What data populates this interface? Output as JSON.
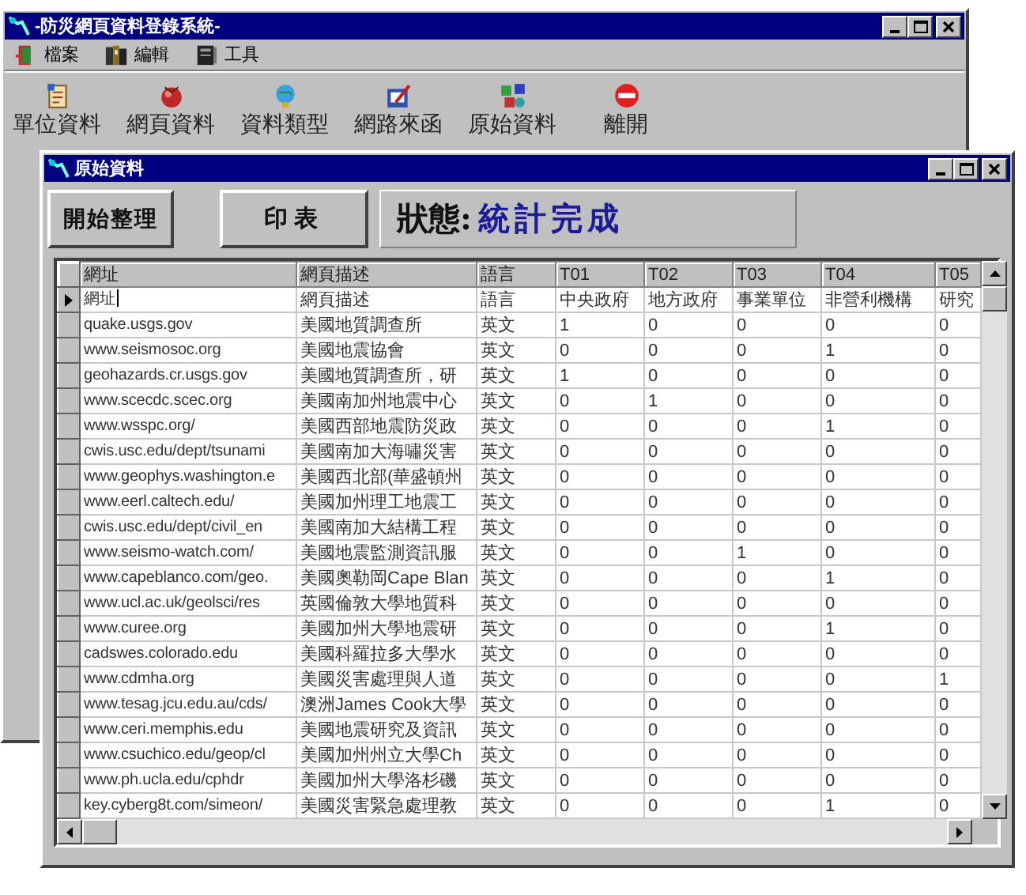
{
  "main_window": {
    "title": "-防災網頁資料登錄系統-",
    "menu": [
      {
        "label": "檔案"
      },
      {
        "label": "編輯"
      },
      {
        "label": "工具"
      }
    ],
    "toolbar": [
      {
        "label": "單位資料"
      },
      {
        "label": "網頁資料"
      },
      {
        "label": "資料類型"
      },
      {
        "label": "網路來函"
      },
      {
        "label": "原始資料"
      },
      {
        "label": "離開"
      }
    ]
  },
  "data_window": {
    "title": "原始資料",
    "buttons": [
      "開始整理",
      "印表"
    ],
    "status": {
      "label": "狀態:",
      "value": "統計完成"
    },
    "table": {
      "columns": [
        "網址",
        "網頁描述",
        "語言",
        "T01",
        "T02",
        "T03",
        "T04",
        "T05"
      ],
      "rows": [
        {
          "current": true,
          "cells": [
            "網址",
            "網頁描述",
            "語言",
            "中央政府",
            "地方政府",
            "事業單位",
            "非營利機構",
            "研究"
          ]
        },
        {
          "current": false,
          "cells": [
            "quake.usgs.gov",
            "美國地質調查所",
            "英文",
            "1",
            "0",
            "0",
            "0",
            "0"
          ]
        },
        {
          "current": false,
          "cells": [
            "www.seismosoc.org",
            "美國地震協會",
            "英文",
            "0",
            "0",
            "0",
            "1",
            "0"
          ]
        },
        {
          "current": false,
          "cells": [
            "geohazards.cr.usgs.gov",
            "美國地質調查所，研",
            "英文",
            "1",
            "0",
            "0",
            "0",
            "0"
          ]
        },
        {
          "current": false,
          "cells": [
            "www.scecdc.scec.org",
            "美國南加州地震中心",
            "英文",
            "0",
            "1",
            "0",
            "0",
            "0"
          ]
        },
        {
          "current": false,
          "cells": [
            "www.wsspc.org/",
            "美國西部地震防災政",
            "英文",
            "0",
            "0",
            "0",
            "1",
            "0"
          ]
        },
        {
          "current": false,
          "cells": [
            "cwis.usc.edu/dept/tsunami",
            "美國南加大海嘯災害",
            "英文",
            "0",
            "0",
            "0",
            "0",
            "0"
          ]
        },
        {
          "current": false,
          "cells": [
            "www.geophys.washington.e",
            "美國西北部(華盛頓州",
            "英文",
            "0",
            "0",
            "0",
            "0",
            "0"
          ]
        },
        {
          "current": false,
          "cells": [
            "www.eerl.caltech.edu/",
            "美國加州理工地震工",
            "英文",
            "0",
            "0",
            "0",
            "0",
            "0"
          ]
        },
        {
          "current": false,
          "cells": [
            "cwis.usc.edu/dept/civil_en",
            "美國南加大結構工程",
            "英文",
            "0",
            "0",
            "0",
            "0",
            "0"
          ]
        },
        {
          "current": false,
          "cells": [
            "www.seismo-watch.com/",
            "美國地震監測資訊服",
            "英文",
            "0",
            "0",
            "1",
            "0",
            "0"
          ]
        },
        {
          "current": false,
          "cells": [
            "www.capeblanco.com/geo.",
            "美國奧勒岡Cape Blan",
            "英文",
            "0",
            "0",
            "0",
            "1",
            "0"
          ]
        },
        {
          "current": false,
          "cells": [
            "www.ucl.ac.uk/geolsci/res",
            "英國倫敦大學地質科",
            "英文",
            "0",
            "0",
            "0",
            "0",
            "0"
          ]
        },
        {
          "current": false,
          "cells": [
            "www.curee.org",
            "美國加州大學地震研",
            "英文",
            "0",
            "0",
            "0",
            "1",
            "0"
          ]
        },
        {
          "current": false,
          "cells": [
            "cadswes.colorado.edu",
            "美國科羅拉多大學水",
            "英文",
            "0",
            "0",
            "0",
            "0",
            "0"
          ]
        },
        {
          "current": false,
          "cells": [
            "www.cdmha.org",
            "美國災害處理與人道",
            "英文",
            "0",
            "0",
            "0",
            "0",
            "1"
          ]
        },
        {
          "current": false,
          "cells": [
            "www.tesag.jcu.edu.au/cds/",
            "澳洲James Cook大學",
            "英文",
            "0",
            "0",
            "0",
            "0",
            "0"
          ]
        },
        {
          "current": false,
          "cells": [
            "www.ceri.memphis.edu",
            "美國地震研究及資訊",
            "英文",
            "0",
            "0",
            "0",
            "0",
            "0"
          ]
        },
        {
          "current": false,
          "cells": [
            "www.csuchico.edu/geop/cl",
            "美國加州州立大學Ch",
            "英文",
            "0",
            "0",
            "0",
            "0",
            "0"
          ]
        },
        {
          "current": false,
          "cells": [
            "www.ph.ucla.edu/cphdr",
            "美國加州大學洛杉磯",
            "英文",
            "0",
            "0",
            "0",
            "0",
            "0"
          ]
        },
        {
          "current": false,
          "cells": [
            "key.cyberg8t.com/simeon/",
            "美國災害緊急處理教",
            "英文",
            "0",
            "0",
            "0",
            "1",
            "0"
          ]
        }
      ]
    }
  }
}
